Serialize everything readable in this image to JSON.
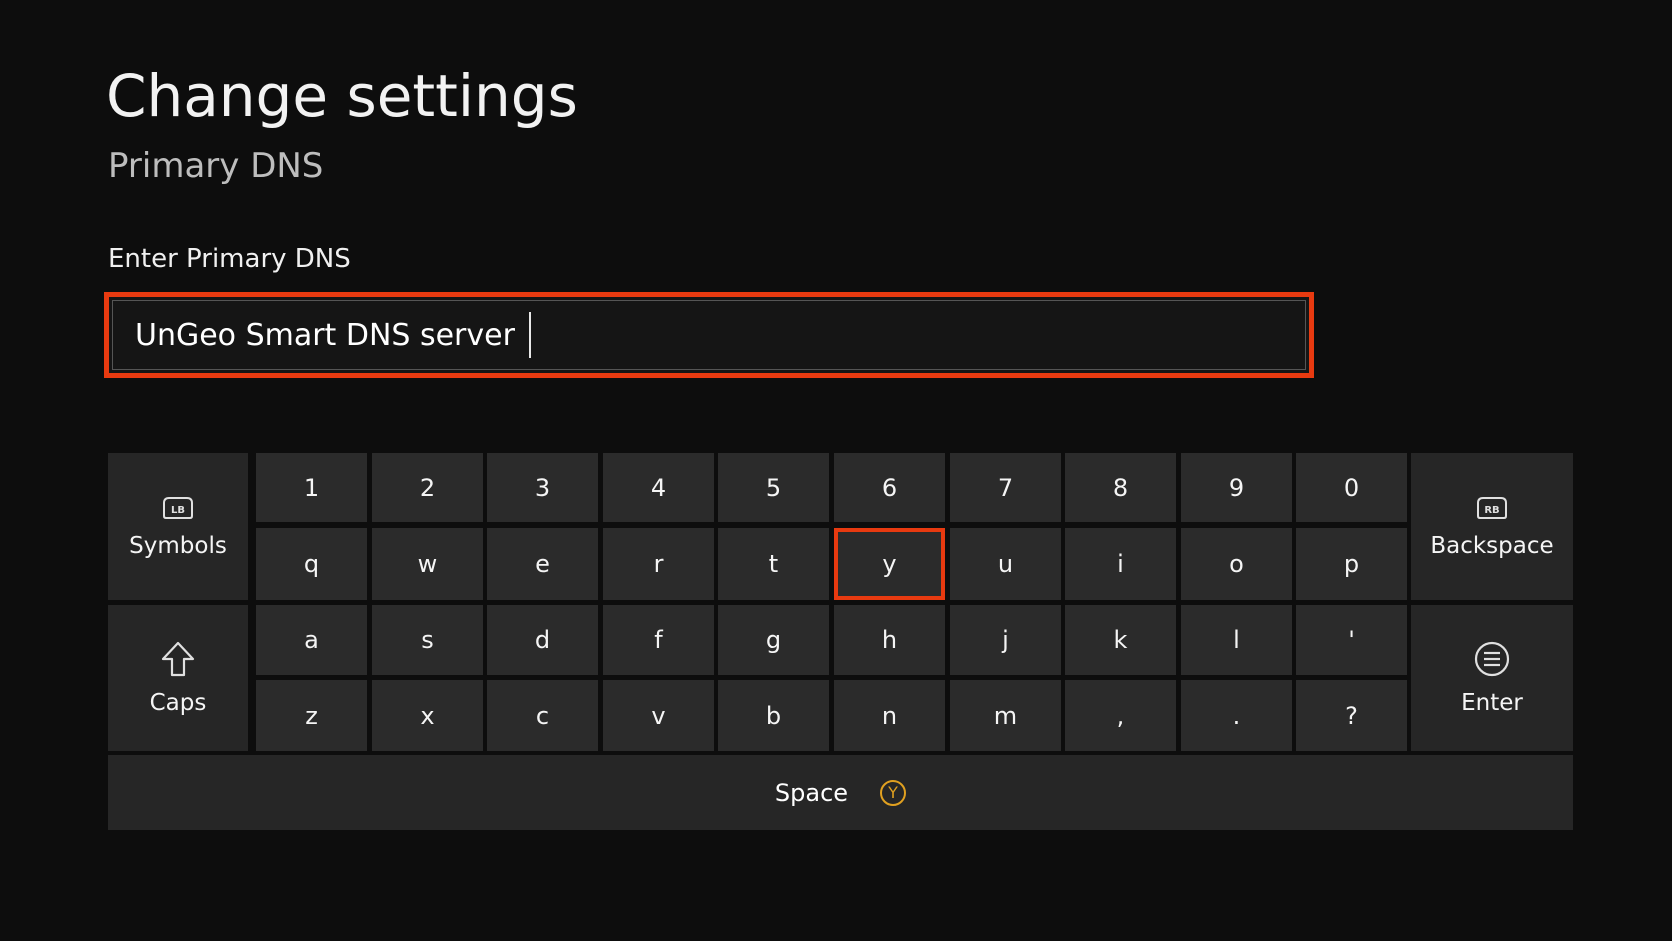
{
  "header": {
    "title": "Change settings",
    "subtitle": "Primary DNS"
  },
  "field": {
    "label": "Enter Primary DNS",
    "value": "UnGeo Smart DNS server"
  },
  "keyboard": {
    "symbols_label": "Symbols",
    "symbols_badge": "LB",
    "backspace_label": "Backspace",
    "backspace_badge": "RB",
    "caps_label": "Caps",
    "enter_label": "Enter",
    "space_label": "Space",
    "space_badge": "Y",
    "focused_key": "y",
    "rows": [
      [
        "1",
        "2",
        "3",
        "4",
        "5",
        "6",
        "7",
        "8",
        "9",
        "0"
      ],
      [
        "q",
        "w",
        "e",
        "r",
        "t",
        "y",
        "u",
        "i",
        "o",
        "p"
      ],
      [
        "a",
        "s",
        "d",
        "f",
        "g",
        "h",
        "j",
        "k",
        "l",
        "'"
      ],
      [
        "z",
        "x",
        "c",
        "v",
        "b",
        "n",
        "m",
        ",",
        ".",
        "?"
      ]
    ]
  },
  "colors": {
    "accent": "#e83a10",
    "background": "#0d0d0d",
    "key": "#2b2b2b",
    "badge_y": "#e0a020"
  }
}
